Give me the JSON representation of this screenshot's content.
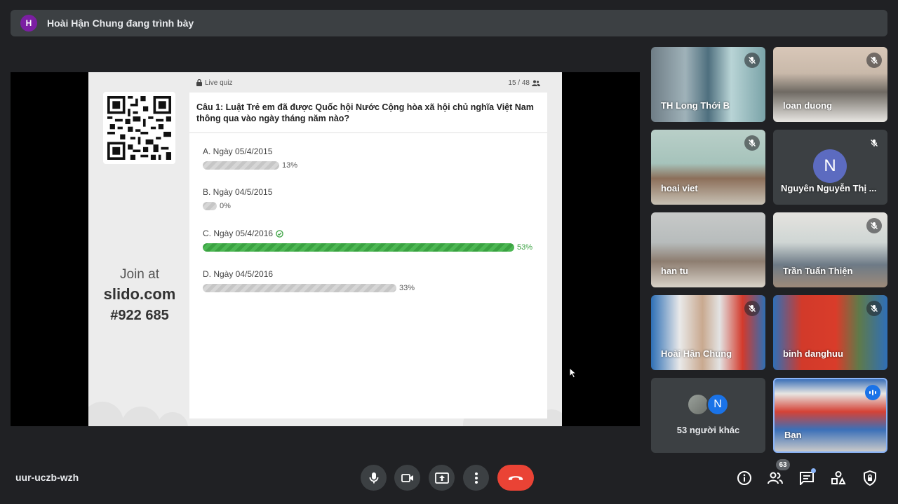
{
  "presenter_bar": {
    "avatar_letter": "H",
    "text": "Hoài Hận Chung đang trình bày"
  },
  "slide": {
    "live_quiz_label": "Live quiz",
    "participants": "15 / 48",
    "join_at": "Join at",
    "join_url": "slido.com",
    "join_code": "#922 685",
    "question": "Câu 1: Luật Trẻ em đã được Quốc hội Nước Cộng hòa xã hội chủ nghĩa Việt Nam thông qua vào ngày tháng năm nào?",
    "options": [
      {
        "label": "A. Ngày 05/4/2015",
        "percent_label": "13%",
        "value": 13,
        "correct": false
      },
      {
        "label": "B. Ngày 04/5/2015",
        "percent_label": "0%",
        "value": 0,
        "correct": false
      },
      {
        "label": "C. Ngày 05/4/2016",
        "percent_label": "53%",
        "value": 53,
        "correct": true
      },
      {
        "label": "D. Ngày 04/5/2016",
        "percent_label": "33%",
        "value": 33,
        "correct": false
      }
    ]
  },
  "tiles": [
    {
      "name": "TH Long Thới B",
      "muted": true
    },
    {
      "name": "loan duong",
      "muted": true
    },
    {
      "name": "hoai viet",
      "muted": true
    },
    {
      "name": "Nguyên Nguyễn Thị ...",
      "muted": true,
      "avatar_letter": "N"
    },
    {
      "name": "han tu",
      "muted": false
    },
    {
      "name": "Trần Tuấn Thiện",
      "muted": true
    },
    {
      "name": "Hoài Hận Chung",
      "muted": true
    },
    {
      "name": "binh danghuu",
      "muted": true
    },
    {
      "name": "53 người khác",
      "avatar_letter": "N"
    },
    {
      "name": "Bạn",
      "speaking": true
    }
  ],
  "bottom": {
    "meeting_code": "uur-uczb-wzh",
    "participants_badge": "63"
  },
  "colors": {
    "end_call": "#ea4335",
    "correct": "#3aa241",
    "accent": "#8ab4f8"
  }
}
